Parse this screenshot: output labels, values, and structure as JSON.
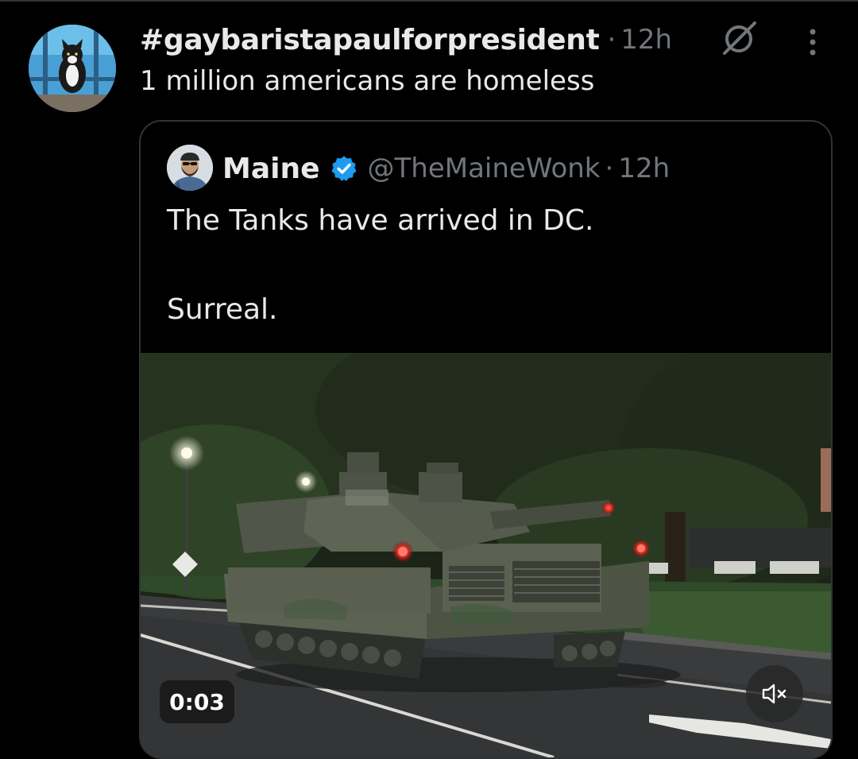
{
  "post": {
    "display_name": "#gaybaristapaulforpresident",
    "separator": "·",
    "time": "12h",
    "text": "1 million americans are homeless",
    "avatar_icon": "cat-avatar",
    "actions": [
      "grok-icon",
      "more-icon"
    ]
  },
  "quote": {
    "display_name": "Maine",
    "verified": true,
    "handle": "@TheMaineWonk",
    "separator": "·",
    "time": "12h",
    "text_line1": "The Tanks have arrived in DC.",
    "text_line2": "Surreal.",
    "avatar_icon": "bearded-man-avatar"
  },
  "media": {
    "type": "video",
    "duration": "0:03",
    "muted": true,
    "description_icon": "tank-on-street"
  },
  "colors": {
    "background": "#000000",
    "text_primary": "#e7e9ea",
    "text_secondary": "#71767b",
    "border": "#2f3336",
    "verified_blue": "#1d9bf0"
  }
}
